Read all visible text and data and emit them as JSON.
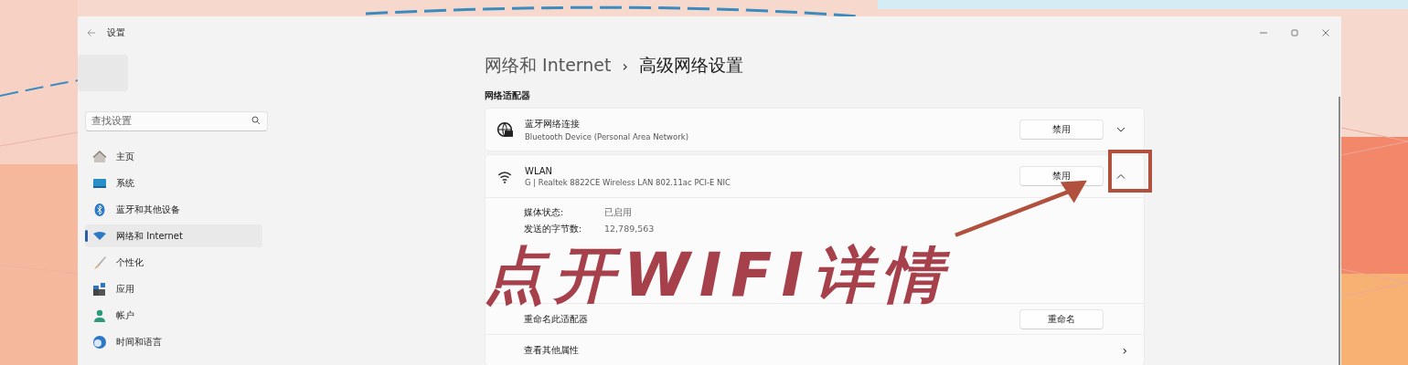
{
  "window": {
    "title": "设置"
  },
  "sidebar": {
    "search": {
      "placeholder": "查找设置"
    },
    "items": [
      {
        "label": "主页",
        "selected": false
      },
      {
        "label": "系统",
        "selected": false
      },
      {
        "label": "蓝牙和其他设备",
        "selected": false
      },
      {
        "label": "网络和 Internet",
        "selected": true
      },
      {
        "label": "个性化",
        "selected": false
      },
      {
        "label": "应用",
        "selected": false
      },
      {
        "label": "帐户",
        "selected": false
      },
      {
        "label": "时间和语言",
        "selected": false
      }
    ]
  },
  "main": {
    "breadcrumb": {
      "parent": "网络和 Internet",
      "separator": "›",
      "current": "高级网络设置"
    },
    "section_label": "网络适配器",
    "adapters": [
      {
        "name": "蓝牙网络连接",
        "description": "Bluetooth Device (Personal Area Network)",
        "button": "禁用",
        "expanded": false
      },
      {
        "name": "WLAN",
        "description": "G | Realtek 8822CE Wireless LAN 802.11ac PCI-E NIC",
        "button": "禁用",
        "expanded": true,
        "details": [
          {
            "label": "媒体状态:",
            "value": "已启用"
          },
          {
            "label": "发送的字节数:",
            "value": "12,789,563"
          }
        ],
        "actions": [
          {
            "kind": "button",
            "label": "重命名此适配器",
            "button": "重命名"
          },
          {
            "kind": "link",
            "label": "查看其他属性",
            "chevron": "›"
          }
        ]
      }
    ]
  },
  "annotation": {
    "text": "点开WIFI详情"
  }
}
